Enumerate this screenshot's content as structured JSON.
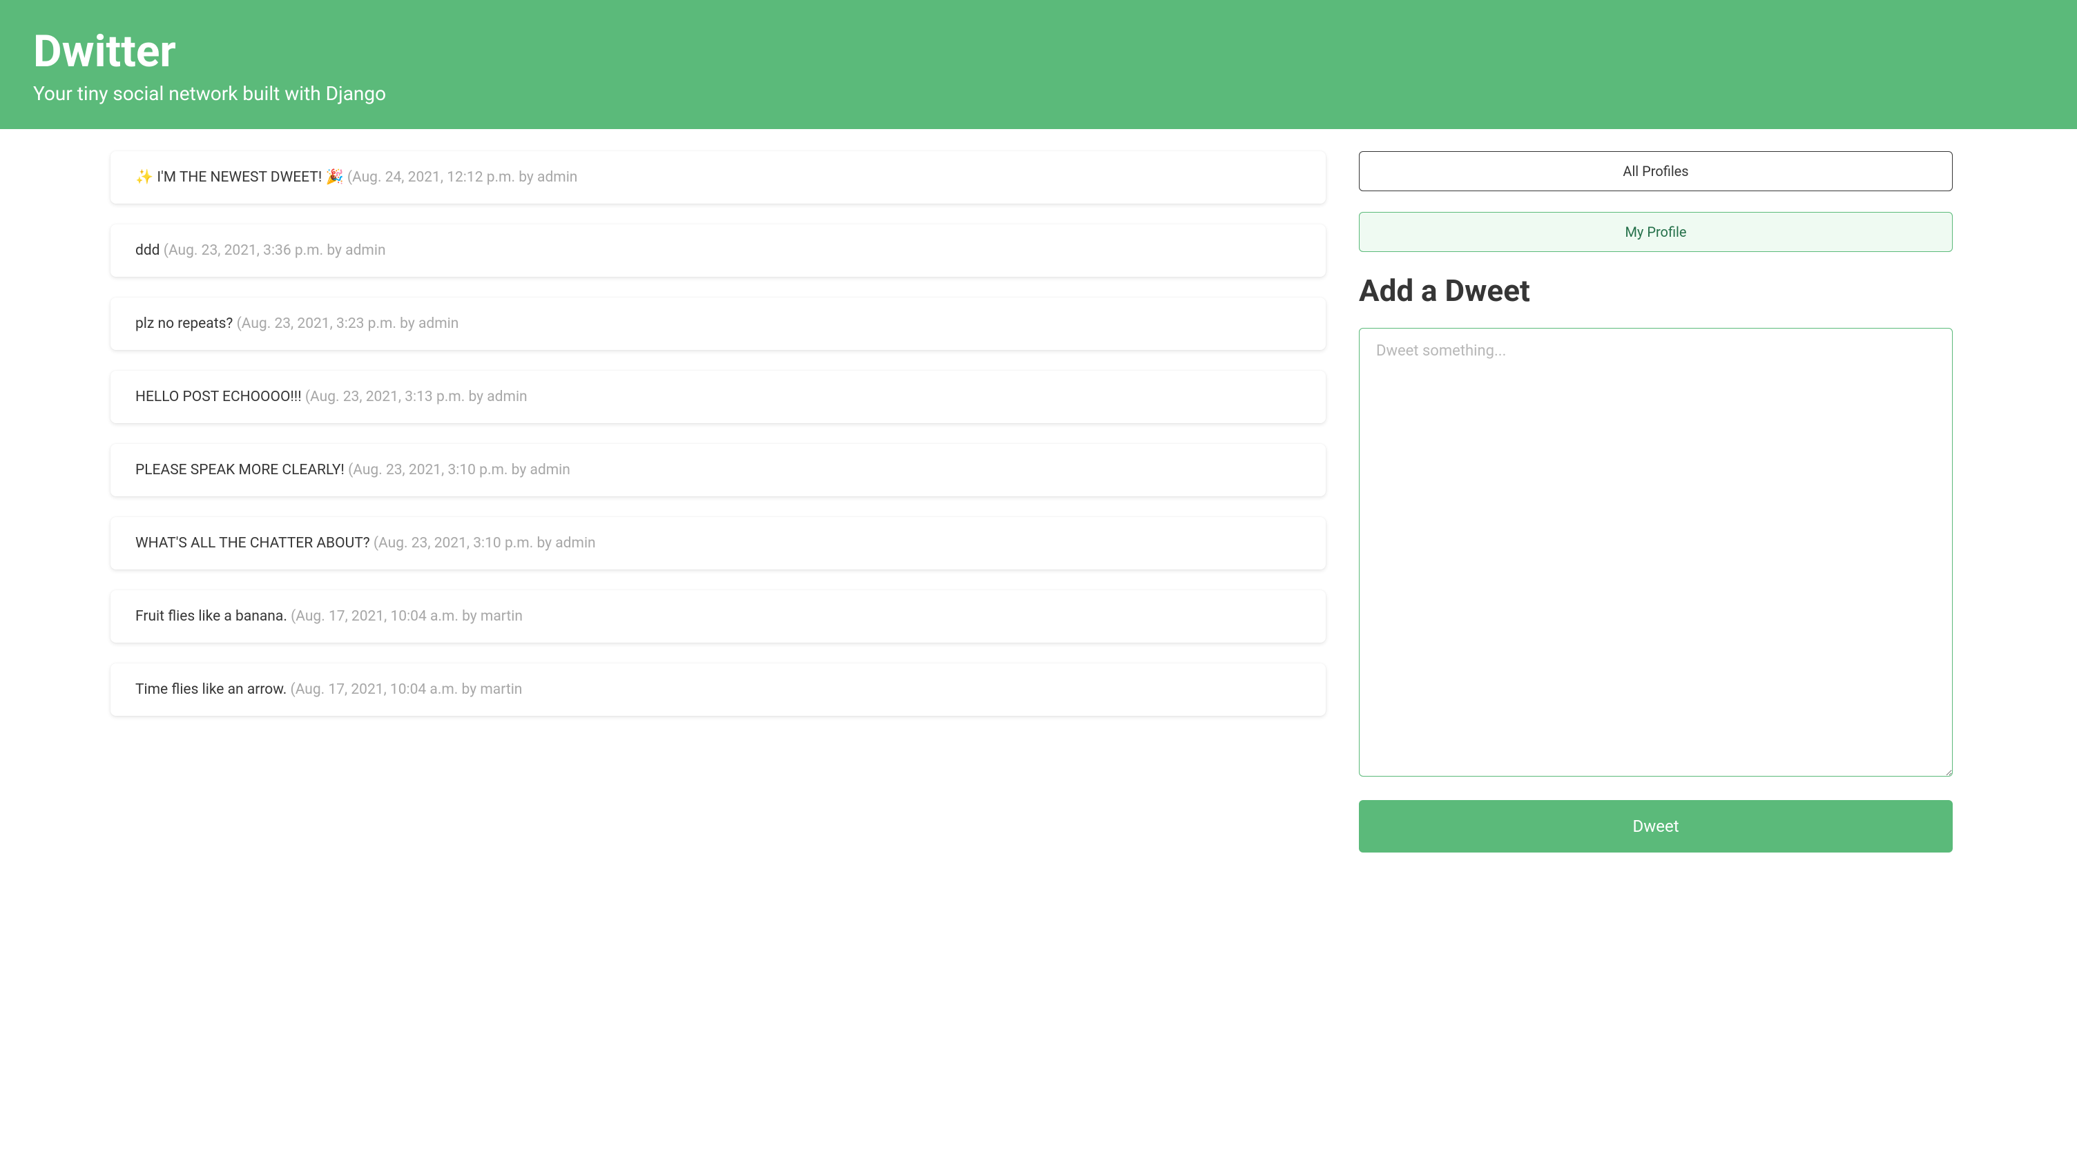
{
  "hero": {
    "title": "Dwitter",
    "subtitle": "Your tiny social network built with Django"
  },
  "nav": {
    "all_profiles": "All Profiles",
    "my_profile": "My Profile"
  },
  "compose": {
    "heading": "Add a Dweet",
    "placeholder": "Dweet something...",
    "submit_label": "Dweet"
  },
  "dweets": [
    {
      "body": "✨ I'M THE NEWEST DWEET! 🎉",
      "meta": "(Aug. 24, 2021, 12:12 p.m. by admin"
    },
    {
      "body": "ddd",
      "meta": "(Aug. 23, 2021, 3:36 p.m. by admin"
    },
    {
      "body": "plz no repeats?",
      "meta": "(Aug. 23, 2021, 3:23 p.m. by admin"
    },
    {
      "body": "HELLO POST ECHOOOO!!!",
      "meta": "(Aug. 23, 2021, 3:13 p.m. by admin"
    },
    {
      "body": "PLEASE SPEAK MORE CLEARLY!",
      "meta": "(Aug. 23, 2021, 3:10 p.m. by admin"
    },
    {
      "body": "WHAT'S ALL THE CHATTER ABOUT?",
      "meta": "(Aug. 23, 2021, 3:10 p.m. by admin"
    },
    {
      "body": "Fruit flies like a banana.",
      "meta": "(Aug. 17, 2021, 10:04 a.m. by martin"
    },
    {
      "body": "Time flies like an arrow.",
      "meta": "(Aug. 17, 2021, 10:04 a.m. by martin"
    }
  ]
}
